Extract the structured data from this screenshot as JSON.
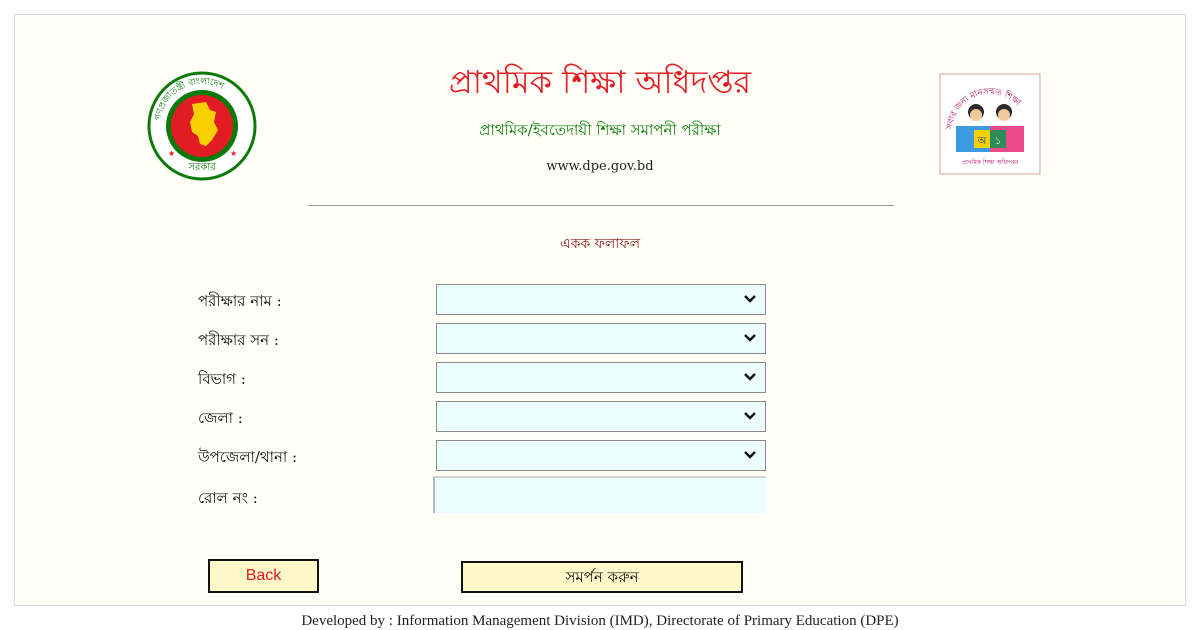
{
  "header": {
    "title": "প্রাথমিক শিক্ষা অধিদপ্তর",
    "subtitle": "প্রাথমিক/ইবতেদায়ী শিক্ষা সমাপনী পরীক্ষা",
    "website": "www.dpe.gov.bd",
    "left_logo": {
      "name": "government-seal-icon",
      "arc_text": "গণপ্রজাতন্ত্রী বাংলাদেশ",
      "bottom_text": "সরকার"
    },
    "right_logo": {
      "name": "dpe-logo-icon",
      "arc_text": "সবার জন্য মানসম্মত শিক্ষা",
      "footer_text": "প্রাথমিক শিক্ষা অধিদপ্তর"
    }
  },
  "section_title": "একক ফলাফল",
  "form": {
    "fields": [
      {
        "label": "পরীক্ষার নাম :",
        "type": "select",
        "value": ""
      },
      {
        "label": "পরীক্ষার সন :",
        "type": "select",
        "value": ""
      },
      {
        "label": "বিভাগ :",
        "type": "select",
        "value": ""
      },
      {
        "label": "জেলা :",
        "type": "select",
        "value": ""
      },
      {
        "label": "উপজেলা/থানা :",
        "type": "select",
        "value": ""
      },
      {
        "label": "রোল নং :",
        "type": "text",
        "value": ""
      }
    ]
  },
  "buttons": {
    "back": "Back",
    "submit": "সমর্পন করুন"
  },
  "footer": "Developed by : Information Management Division (IMD), Directorate of Primary Education (DPE)",
  "colors": {
    "title_red": "#e31b23",
    "subtitle_green": "#0a7a0a",
    "section_maroon": "#8b1a1a",
    "field_bg": "#ebfdfd",
    "button_bg": "#fff8c8",
    "page_bg": "#fffff7"
  }
}
